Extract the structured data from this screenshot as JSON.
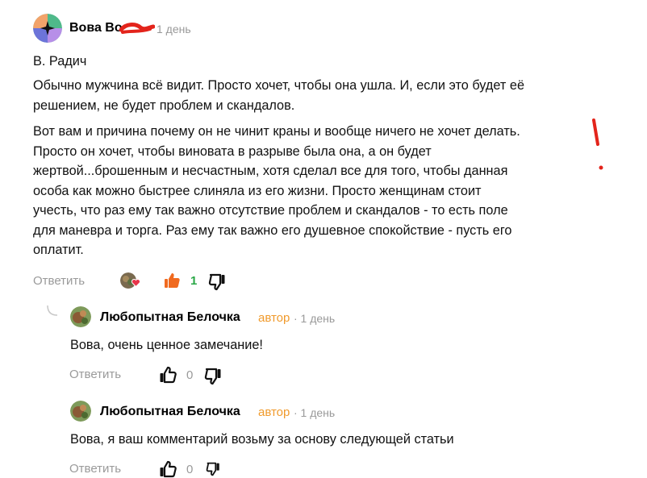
{
  "main_comment": {
    "author": "Вова Во",
    "time": "1 день",
    "quote": "В. Радич",
    "paragraph1": [
      "Обычно мужчина всё видит. Просто хочет, чтобы она ушла. И, если это будет её",
      "решением, не будет проблем и скандалов."
    ],
    "paragraph2": [
      "Вот вам и причина почему он не чинит краны и вообще ничего не хочет делать.",
      "Просто он хочет, чтобы виновата в разрыве была она, а он будет",
      "жертвой...брошенным и несчастным, хотя сделал все для того, чтобы данная",
      "особа как можно быстрее слиняла из его жизни. Просто женщинам стоит",
      "учесть, что раз ему так важно отсутствие проблем и скандалов - то есть поле",
      "для маневра и торга. Раз ему так важно его душевное спокойствие - пусть его",
      "оплатит."
    ],
    "reply_label": "Ответить",
    "likes": "1"
  },
  "replies": [
    {
      "author": "Любопытная Белочка",
      "badge": "автор",
      "time": "· 1 день",
      "text": "Вова, очень ценное замечание!",
      "reply_label": "Ответить",
      "likes": "0"
    },
    {
      "author": "Любопытная Белочка",
      "badge": "автор",
      "time": "· 1 день",
      "text": "Вова, я ваш комментарий возьму за основу следующей статьи",
      "reply_label": "Ответить",
      "likes": "0"
    }
  ],
  "colors": {
    "author_badge": "#f09a2c",
    "like_active": "#f06a1f",
    "like_count_active": "#28a745",
    "annotation": "#e3241b"
  },
  "icons": [
    "user-avatar-icon",
    "thumbs-up-icon",
    "thumbs-down-icon",
    "heart-reaction-icon",
    "reply-thread-icon"
  ]
}
